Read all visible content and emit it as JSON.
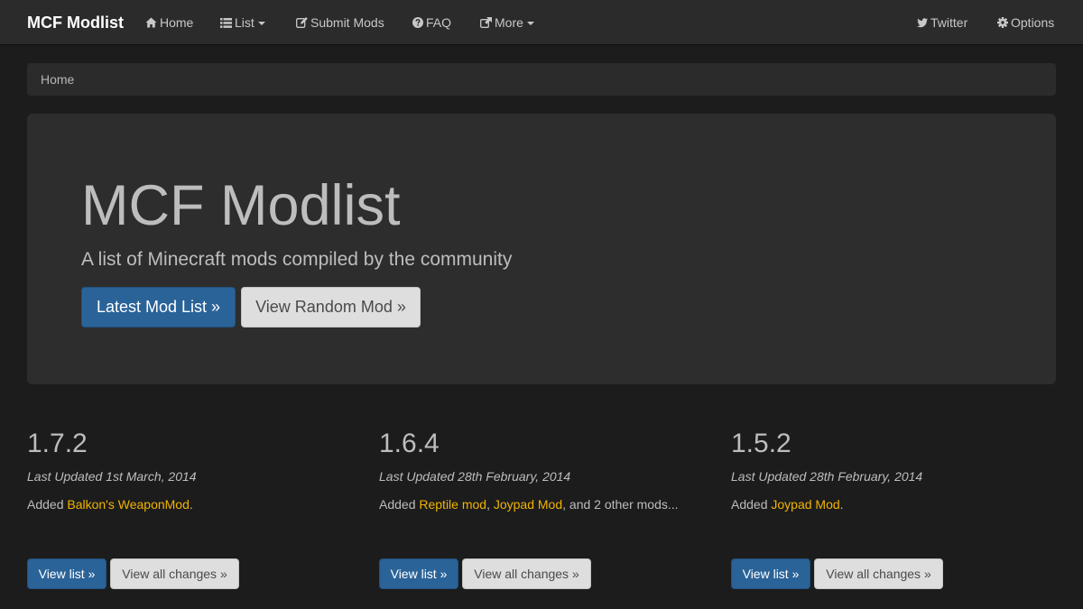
{
  "navbar": {
    "brand": "MCF Modlist",
    "items": {
      "home": "Home",
      "list": "List",
      "submit": "Submit Mods",
      "faq": "FAQ",
      "more": "More",
      "twitter": "Twitter",
      "options": "Options"
    }
  },
  "breadcrumb": {
    "current": "Home"
  },
  "jumbotron": {
    "title": "MCF Modlist",
    "subtitle": "A list of Minecraft mods compiled by the community",
    "primary_button": "Latest Mod List »",
    "secondary_button": "View Random Mod »"
  },
  "versions": [
    {
      "version": "1.7.2",
      "updated": "Last Updated 1st March, 2014",
      "prefix": "Added ",
      "mod1": "Balkon's WeaponMod",
      "suffix": ".",
      "view_list": "View list »",
      "view_changes": "View all changes »"
    },
    {
      "version": "1.6.4",
      "updated": "Last Updated 28th February, 2014",
      "prefix": "Added ",
      "mod1": "Reptile mod",
      "sep": ", ",
      "mod2": "Joypad Mod",
      "suffix": ", and 2 other mods...",
      "view_list": "View list »",
      "view_changes": "View all changes »"
    },
    {
      "version": "1.5.2",
      "updated": "Last Updated 28th February, 2014",
      "prefix": "Added ",
      "mod1": "Joypad Mod",
      "suffix": ".",
      "view_list": "View list »",
      "view_changes": "View all changes »"
    }
  ],
  "colors": {
    "background": "#1c1c1c",
    "navbar": "#2b2b2b",
    "jumbotron": "#2d2d2d",
    "primary": "#2a6398",
    "link": "#f0b400"
  }
}
